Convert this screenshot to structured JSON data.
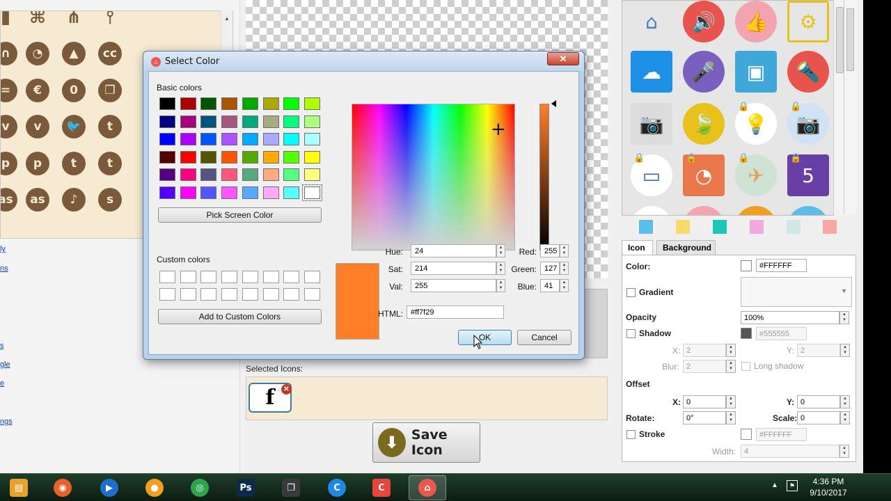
{
  "left_panel": {
    "icons": [
      {
        "icon": "bars-icon",
        "glyph": "▮"
      },
      {
        "icon": "tree-icon",
        "glyph": "⌘"
      },
      {
        "icon": "hierarchy-icon",
        "glyph": "⋔"
      },
      {
        "icon": "pin-icon",
        "glyph": "⫯"
      },
      {
        "icon": "magnet-icon",
        "glyph": "∩"
      },
      {
        "icon": "gauge-icon",
        "glyph": "◔"
      },
      {
        "icon": "cone-icon",
        "glyph": "▲"
      },
      {
        "icon": "creative-commons-icon",
        "glyph": "cc"
      },
      {
        "icon": "equals-icon",
        "glyph": "="
      },
      {
        "icon": "nc-icon",
        "glyph": "€"
      },
      {
        "icon": "zero-icon",
        "glyph": "0"
      },
      {
        "icon": "copy-icon",
        "glyph": "❐"
      },
      {
        "icon": "vine-icon",
        "glyph": "v"
      },
      {
        "icon": "vimeo-icon",
        "glyph": "v"
      },
      {
        "icon": "twitter-icon",
        "glyph": "🐦"
      },
      {
        "icon": "twitter-circle-icon",
        "glyph": "t"
      },
      {
        "icon": "pinterest-icon",
        "glyph": "p"
      },
      {
        "icon": "pinterest-circle-icon",
        "glyph": "p"
      },
      {
        "icon": "tumblr-icon",
        "glyph": "t"
      },
      {
        "icon": "tumblr-circle-icon",
        "glyph": "t"
      },
      {
        "icon": "lastfm-icon",
        "glyph": "as"
      },
      {
        "icon": "lastfm-circle-icon",
        "glyph": "as"
      },
      {
        "icon": "vine-alt-icon",
        "glyph": "♪"
      },
      {
        "icon": "stumble-icon",
        "glyph": "s"
      }
    ],
    "links": [
      "ly",
      "ns",
      "s",
      "gle",
      "e",
      "ngs"
    ]
  },
  "dialog": {
    "title": "Select Color",
    "close": "✕",
    "basic_colors_label": "Basic colors",
    "basic_colors": [
      "#000000",
      "#aa0000",
      "#005500",
      "#aa5500",
      "#00aa00",
      "#aaaa00",
      "#00ff00",
      "#aaff00",
      "#000080",
      "#aa007f",
      "#005580",
      "#aa557f",
      "#00aa7f",
      "#aaaa7f",
      "#00ff7f",
      "#aaff7f",
      "#0000ff",
      "#aa00ff",
      "#0055ff",
      "#aa55ff",
      "#00aaff",
      "#aaaaff",
      "#00ffff",
      "#aaffff",
      "#550000",
      "#ff0000",
      "#555500",
      "#ff5500",
      "#55aa00",
      "#ffaa00",
      "#55ff00",
      "#ffff00",
      "#550080",
      "#ff007f",
      "#555580",
      "#ff557f",
      "#55aa7f",
      "#ffaa7f",
      "#55ff7f",
      "#ffff7f",
      "#5500ff",
      "#ff00ff",
      "#5555ff",
      "#ff55ff",
      "#55aaff",
      "#ffaaff",
      "#55ffff",
      "#ffffff"
    ],
    "pick_screen_label": "Pick Screen Color",
    "custom_colors_label": "Custom colors",
    "add_custom_label": "Add to Custom Colors",
    "hue_label": "Hue:",
    "hue": "24",
    "sat_label": "Sat:",
    "sat": "214",
    "val_label": "Val:",
    "val": "255",
    "red_label": "Red:",
    "red": "255",
    "green_label": "Green:",
    "green": "127",
    "blue_label": "Blue:",
    "blue": "41",
    "html_label": "HTML:",
    "html": "#ff7f29",
    "current_color": "#ff7f29",
    "ok_label": "OK",
    "cancel_label": "Cancel"
  },
  "selected": {
    "label": "Selected Icons:",
    "icon": "facebook-icon",
    "glyph": "f",
    "remove": "✕"
  },
  "save_button": {
    "label": "Save Icon",
    "icon": "download-icon",
    "glyph": "⬇"
  },
  "preview_icons": [
    {
      "icon": "home-icon",
      "glyph": "⌂",
      "bg": "transparent",
      "fg": "#4a7fbf",
      "locked": false,
      "square": false
    },
    {
      "icon": "volume-icon",
      "glyph": "🔊",
      "bg": "#e8544b",
      "fg": "#ffffff",
      "locked": false,
      "square": false
    },
    {
      "icon": "thumbs-up-icon",
      "glyph": "👍",
      "bg": "#f4a3b0",
      "fg": "#ffffff",
      "locked": false,
      "square": false
    },
    {
      "icon": "gear-icon",
      "glyph": "⚙",
      "bg": "transparent",
      "fg": "#e8c21a",
      "locked": false,
      "square": true
    },
    {
      "icon": "cloud-icon",
      "glyph": "☁",
      "bg": "#1e90e6",
      "fg": "#ffffff",
      "locked": false,
      "square": true
    },
    {
      "icon": "microphone-icon",
      "glyph": "🎤",
      "bg": "#7a5fbf",
      "fg": "#ffffff",
      "locked": false,
      "square": false
    },
    {
      "icon": "contacts-icon",
      "glyph": "▣",
      "bg": "#3fa8d8",
      "fg": "#ffffff",
      "locked": false,
      "square": true
    },
    {
      "icon": "flashlight-icon",
      "glyph": "🔦",
      "bg": "#e8544b",
      "fg": "#ffffff",
      "locked": false,
      "square": false
    },
    {
      "icon": "camera-outline-icon",
      "glyph": "📷",
      "bg": "#dcdcdc",
      "fg": "#bbbbbb",
      "locked": false,
      "square": true
    },
    {
      "icon": "leaf-icon",
      "glyph": "🍃",
      "bg": "#e8c21a",
      "fg": "#ffffff",
      "locked": false,
      "square": false
    },
    {
      "icon": "lightbulb-icon",
      "glyph": "💡",
      "bg": "#ffffff",
      "fg": "#5aa0d8",
      "locked": true,
      "square": false
    },
    {
      "icon": "camera-icon",
      "glyph": "📷",
      "bg": "#cfe3f5",
      "fg": "#3a6da8",
      "locked": true,
      "square": false
    },
    {
      "icon": "presentation-icon",
      "glyph": "▭",
      "bg": "#ffffff",
      "fg": "#3a6da8",
      "locked": true,
      "square": false
    },
    {
      "icon": "pie-chart-icon",
      "glyph": "◔",
      "bg": "#e8784b",
      "fg": "#ffffff",
      "locked": true,
      "square": true
    },
    {
      "icon": "airplane-icon",
      "glyph": "✈",
      "bg": "#cfe3d5",
      "fg": "#e8a04b",
      "locked": true,
      "square": false
    },
    {
      "icon": "html5-icon",
      "glyph": "5",
      "bg": "#6a3fa5",
      "fg": "#ffffff",
      "locked": true,
      "square": true
    }
  ],
  "palette_swatches": [
    "#5bbde8",
    "#f8d96a",
    "#1ec7b5",
    "#f4a8e0",
    "#d2e8e4",
    "#f8a8a0"
  ],
  "tabs": {
    "icon": "Icon",
    "background": "Background"
  },
  "properties": {
    "color_label": "Color:",
    "color_value": "#FFFFFF",
    "gradient_label": "Gradient",
    "opacity_label": "Opacity",
    "opacity_value": "100%",
    "shadow_label": "Shadow",
    "shadow_value": "#555555",
    "x_label": "X:",
    "x_value": "2",
    "y_label": "Y:",
    "y_value": "2",
    "blur_label": "Blur:",
    "blur_value": "2",
    "long_shadow_label": "Long shadow",
    "offset_label": "Offset",
    "offset_x_label": "X:",
    "offset_x_value": "0",
    "offset_y_label": "Y:",
    "offset_y_value": "0",
    "rotate_label": "Rotate:",
    "rotate_value": "0°",
    "scale_label": "Scale:",
    "scale_value": "0",
    "stroke_label": "Stroke",
    "stroke_value": "#FFFFFF",
    "width_label": "Width:",
    "width_value": "4"
  },
  "taskbar": {
    "apps": [
      {
        "name": "file-explorer",
        "glyph": "▤",
        "color": "#e8a12b"
      },
      {
        "name": "firefox",
        "glyph": "◉",
        "color": "#e8602b"
      },
      {
        "name": "media-player",
        "glyph": "▶",
        "color": "#1e6fc9"
      },
      {
        "name": "app-orange",
        "glyph": "●",
        "color": "#f0a020"
      },
      {
        "name": "chrome",
        "glyph": "◎",
        "color": "#2ea44f"
      },
      {
        "name": "photoshop",
        "glyph": "Ps",
        "color": "#0d2a4a"
      },
      {
        "name": "window-switcher",
        "glyph": "❐",
        "color": "#3a3a3a"
      },
      {
        "name": "app-blue-circle",
        "glyph": "C",
        "color": "#1e88e5"
      },
      {
        "name": "app-red",
        "glyph": "C",
        "color": "#e8453c"
      },
      {
        "name": "icon-generator",
        "glyph": "⌂",
        "color": "#e85a4f"
      }
    ],
    "time": "4:36 PM",
    "date": "9/10/2017",
    "tray_arrow": "▲"
  }
}
